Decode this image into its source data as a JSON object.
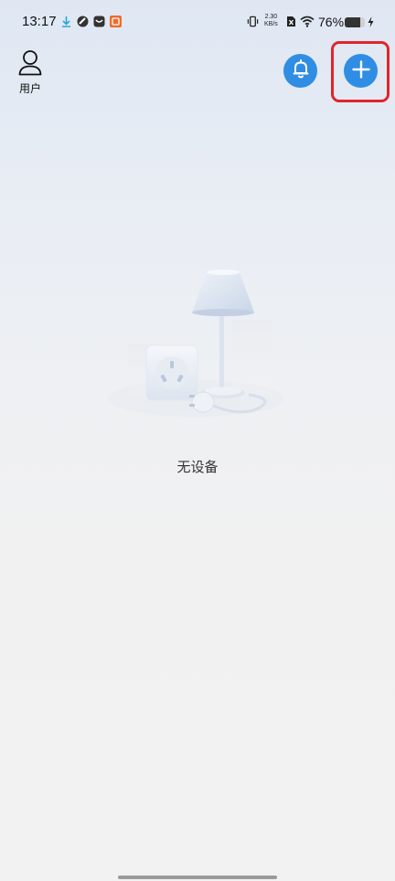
{
  "status_bar": {
    "time": "13:17",
    "net_speed_value": "2.30",
    "net_speed_unit": "KB/s",
    "battery_percent": "76%",
    "battery_level": 0.76,
    "icons": [
      "download-icon",
      "app-icon",
      "mail-app-icon",
      "shopping-app-icon",
      "vibrate-icon",
      "sim-off-icon",
      "wifi-icon",
      "battery-icon",
      "charging-icon"
    ]
  },
  "header": {
    "user_label": "用户",
    "icons": {
      "user": "user-icon",
      "bell": "bell-icon",
      "add": "plus-icon"
    }
  },
  "empty_state": {
    "message": "无设备",
    "illustration": "lamp-and-socket-illustration"
  },
  "colors": {
    "accent": "#2f8de4",
    "highlight": "#e0252b"
  }
}
